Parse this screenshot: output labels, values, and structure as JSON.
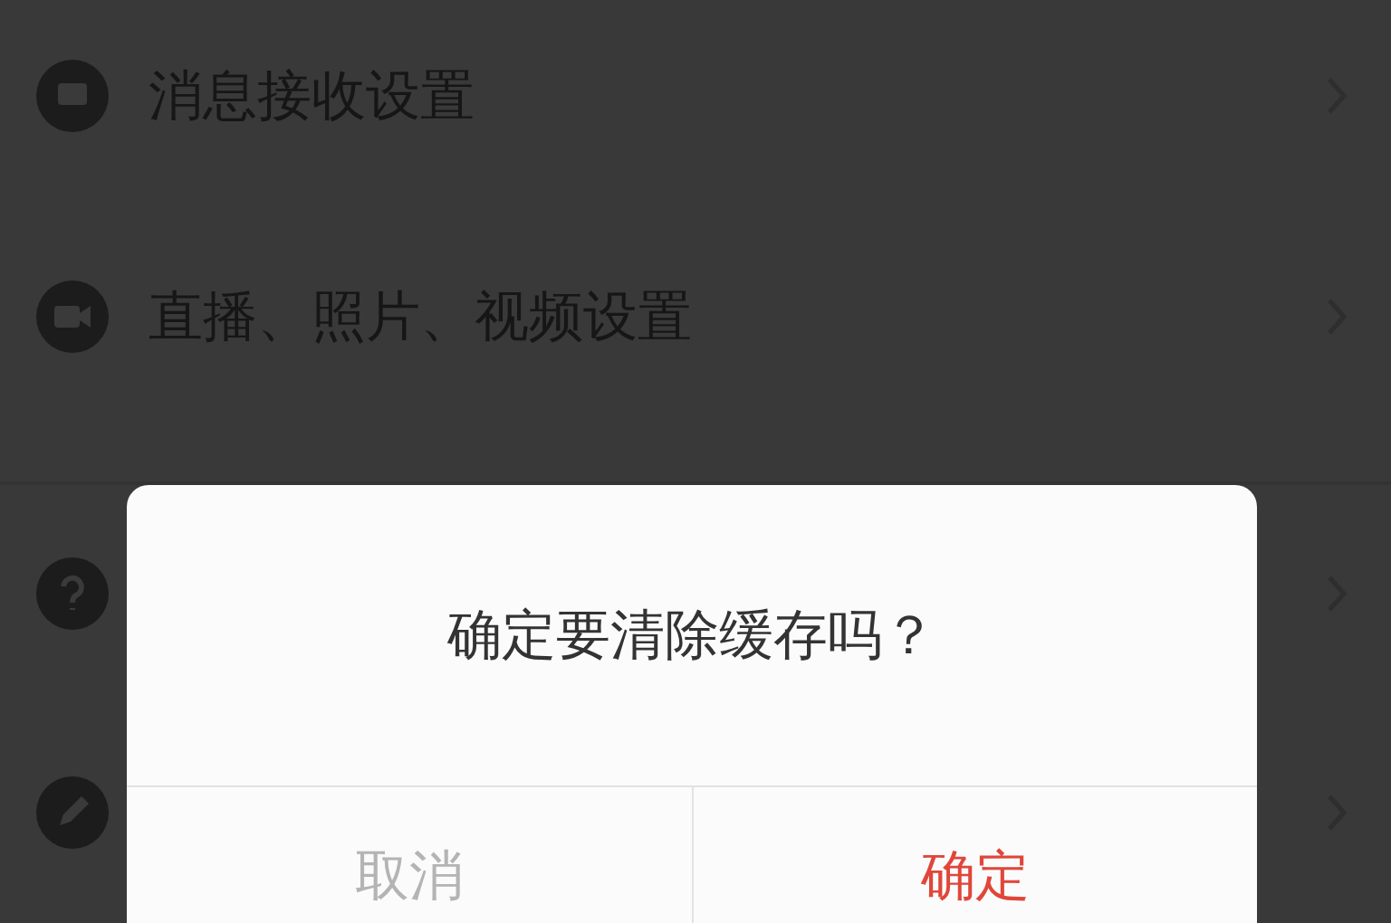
{
  "settings_items": [
    {
      "kind": "message",
      "label": "消息接收设置"
    },
    {
      "kind": "video",
      "label": "直播、照片、视频设置"
    },
    {
      "kind": "help"
    },
    {
      "kind": "edit"
    }
  ],
  "dialog": {
    "message": "确定要清除缓存吗？",
    "buttons": [
      {
        "kind": "cancel",
        "label": "取消"
      },
      {
        "kind": "confirm",
        "label": "确定"
      }
    ]
  }
}
